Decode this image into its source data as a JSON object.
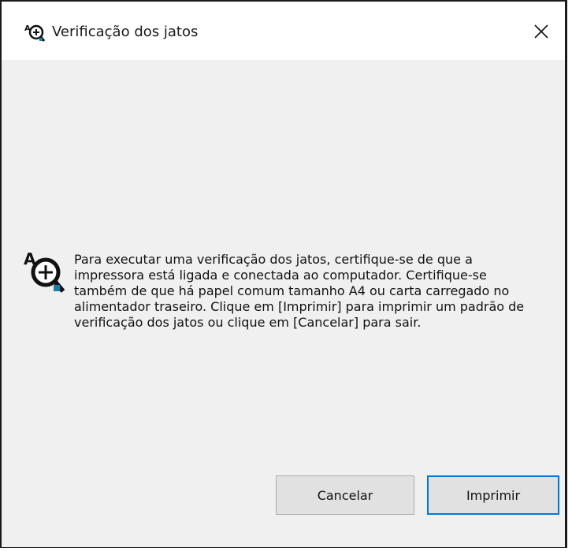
{
  "window": {
    "title": "Verificação dos jatos",
    "icon": "nozzle-check-icon",
    "close_icon": "close-icon"
  },
  "message": {
    "icon": "nozzle-check-magnifier-icon",
    "text": "Para executar uma verificação dos jatos, certifique-se de que a\nimpressora está ligada e conectada ao computador. Certifique-se\ntambém de que há papel comum tamanho A4 ou carta carregado no\nalimentador traseiro. Clique em [Imprimir] para imprimir um padrão de\nverificação dos jatos ou clique em [Cancelar] para sair."
  },
  "buttons": {
    "cancel_label": "Cancelar",
    "print_label": "Imprimir"
  },
  "colors": {
    "focus_border": "#0078d7",
    "button_face": "#e1e1e1",
    "client_background": "#f0f0f0"
  }
}
